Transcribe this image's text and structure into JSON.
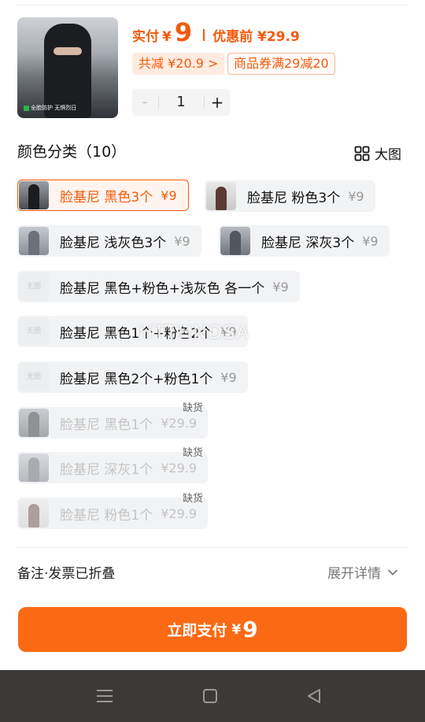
{
  "product": {
    "image_caption": "全脸防护 无惧烈日",
    "price_label": "实付",
    "currency": "¥",
    "price": "9",
    "original_price": "优惠前 ¥29.9",
    "saved_tag": "共减 ¥20.9 >",
    "coupon_tag": "商品券满29减20",
    "quantity": "1",
    "minus": "-",
    "plus": "+"
  },
  "section": {
    "title": "颜色分类（10）",
    "big_view_label": "大图"
  },
  "no_image_label": "无图",
  "options": [
    {
      "name": "脸基尼 黑色3个",
      "price": "¥9",
      "selected": true,
      "disabled": false
    },
    {
      "name": "脸基尼 粉色3个",
      "price": "¥9",
      "selected": false,
      "disabled": false
    },
    {
      "name": "脸基尼 浅灰色3个",
      "price": "¥9",
      "selected": false,
      "disabled": false
    },
    {
      "name": "脸基尼 深灰3个",
      "price": "¥9",
      "selected": false,
      "disabled": false
    },
    {
      "name": "脸基尼 黑色+粉色+浅灰色 各一个",
      "price": "¥9",
      "selected": false,
      "disabled": false
    },
    {
      "name": "脸基尼 黑色1个+粉色2个",
      "price": "¥9",
      "selected": false,
      "disabled": false
    },
    {
      "name": "脸基尼 黑色2个+粉色1个",
      "price": "¥9",
      "selected": false,
      "disabled": false
    },
    {
      "name": "脸基尼 黑色1个",
      "price": "¥29.9",
      "selected": false,
      "disabled": true,
      "stock": "缺货"
    },
    {
      "name": "脸基尼 深灰1个",
      "price": "¥29.9",
      "selected": false,
      "disabled": true,
      "stock": "缺货"
    },
    {
      "name": "脸基尼 粉色1个",
      "price": "¥29.9",
      "selected": false,
      "disabled": true,
      "stock": "缺货"
    }
  ],
  "watermark": "HTTHNDSA",
  "notes": {
    "left": "备注·发票已折叠",
    "right": "展开详情"
  },
  "pay_button": {
    "label": "立即支付",
    "currency": "¥",
    "amount": "9"
  },
  "colors": {
    "accent": "#f25a0c",
    "button": "#fa6a14",
    "navbar": "#3c3a39"
  }
}
